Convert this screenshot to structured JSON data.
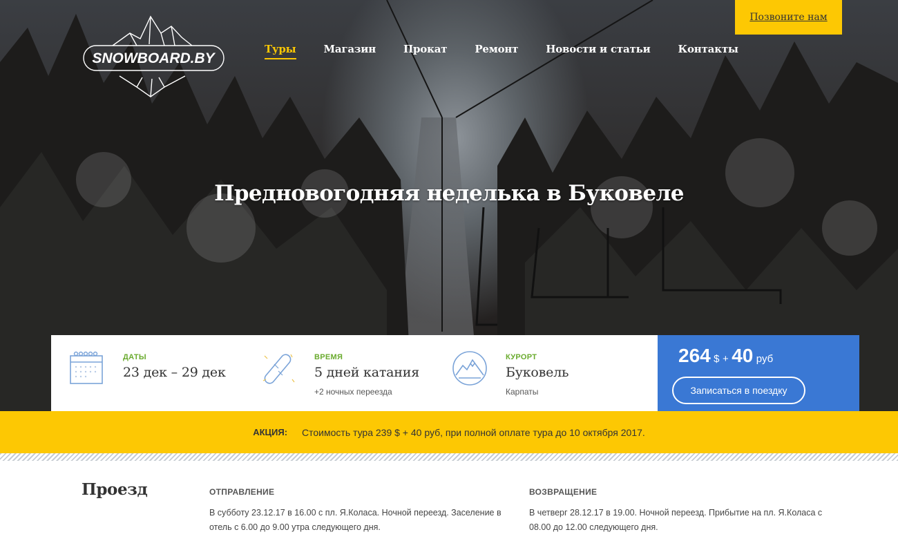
{
  "header": {
    "logo_text": "SNOWBOARD.BY",
    "nav": [
      {
        "label": "Туры",
        "active": true
      },
      {
        "label": "Магазин",
        "active": false
      },
      {
        "label": "Прокат",
        "active": false
      },
      {
        "label": "Ремонт",
        "active": false
      },
      {
        "label": "Новости и статьи",
        "active": false
      },
      {
        "label": "Контакты",
        "active": false
      }
    ],
    "call_label": "Позвоните нам"
  },
  "hero": {
    "title": "Предновогодняя неделька в Буковеле"
  },
  "info": {
    "dates": {
      "label": "ДАТЫ",
      "value": "23 дек – 29 дек",
      "icon": "calendar-icon"
    },
    "time": {
      "label": "ВРЕМЯ",
      "value": "5 дней катания",
      "sub": "+2 ночных переезда",
      "icon": "snowboard-icon"
    },
    "resort": {
      "label": "КУРОРТ",
      "value": "Буковель",
      "sub": "Карпаты",
      "icon": "mountain-icon"
    }
  },
  "price": {
    "amount_usd": "264",
    "usd": "$",
    "plus": "+",
    "amount_rub": "40",
    "rub": "руб",
    "button": "Записаться в поездку"
  },
  "promo": {
    "label": "АКЦИЯ:",
    "text": "Стоимость тура 239 $ + 40 руб, при полной оплате тура до 10 октября 2017."
  },
  "travel": {
    "title": "Проезд",
    "departure": {
      "heading": "ОТПРАВЛЕНИЕ",
      "text": "В субботу 23.12.17 в 16.00 с пл. Я.Коласа. Ночной переезд. Заселение в отель с 6.00 до 9.00 утра следующего дня."
    },
    "return": {
      "heading": "ВОЗВРАЩЕНИЕ",
      "text": "В четверг 28.12.17 в 19.00. Ночной переезд. Прибытие на пл. Я.Коласа с 08.00 до 12.00 следующего дня."
    }
  },
  "colors": {
    "accent": "#fdc803",
    "price_bg": "#3a78d4",
    "label_green": "#6aab2e"
  }
}
